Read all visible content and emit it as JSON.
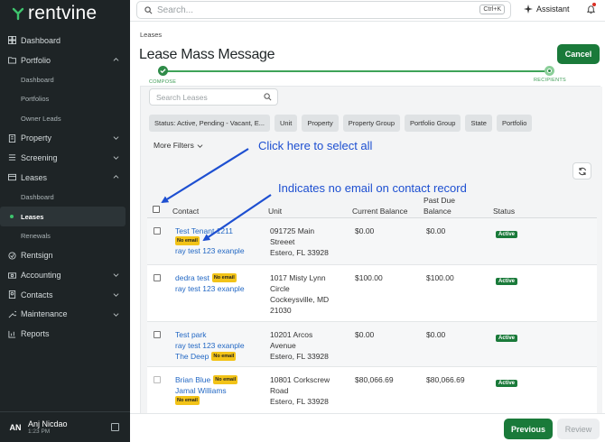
{
  "app": {
    "brand": "rentvine",
    "search_placeholder": "Search...",
    "search_shortcut": "Ctrl+K",
    "assistant_label": "Assistant"
  },
  "sidebar": {
    "items": [
      {
        "label": "Dashboard",
        "icon": "dashboard-icon"
      },
      {
        "label": "Portfolio",
        "icon": "folder-icon",
        "expanded": true
      },
      {
        "label": "Dashboard",
        "sub": true
      },
      {
        "label": "Portfolios",
        "sub": true
      },
      {
        "label": "Owner Leads",
        "sub": true
      },
      {
        "label": "Property",
        "icon": "building-icon"
      },
      {
        "label": "Screening",
        "icon": "list-icon"
      },
      {
        "label": "Leases",
        "icon": "layers-icon",
        "expanded": true
      },
      {
        "label": "Dashboard",
        "sub": true
      },
      {
        "label": "Leases",
        "sub": true,
        "active": true
      },
      {
        "label": "Renewals",
        "sub": true
      },
      {
        "label": "Rentsign",
        "icon": "sign-icon"
      },
      {
        "label": "Accounting",
        "icon": "dollar-icon"
      },
      {
        "label": "Contacts",
        "icon": "contacts-icon"
      },
      {
        "label": "Maintenance",
        "icon": "wrench-icon"
      },
      {
        "label": "Reports",
        "icon": "chart-icon"
      }
    ],
    "user": {
      "initials": "AN",
      "name": "Anj Nicdao",
      "time": "1:23 PM"
    }
  },
  "header": {
    "breadcrumb": "Leases",
    "title": "Lease Mass Message",
    "cancel_label": "Cancel",
    "steps": [
      "COMPOSE",
      "RECIPIENTS"
    ]
  },
  "filters": {
    "search_placeholder": "Search Leases",
    "chips": [
      "Status: Active, Pending - Vacant, E...",
      "Unit",
      "Property",
      "Property Group",
      "Portfolio Group",
      "State",
      "Portfolio"
    ],
    "more_filters_label": "More Filters"
  },
  "table": {
    "headers": {
      "contact": "Contact",
      "unit": "Unit",
      "balance": "Current Balance",
      "past_due_1": "Past Due",
      "past_due_2": "Balance",
      "status": "Status"
    },
    "no_email_label": "No email",
    "rows": [
      {
        "contacts": [
          "Test Tenant 1211",
          "ray test 123 exanple"
        ],
        "unit": [
          "091725 Main",
          "Streeet",
          "Estero, FL 33928"
        ],
        "balance": "$0.00",
        "past_due": "$0.00",
        "status": "Active"
      },
      {
        "contacts": [
          "dedra test",
          "ray test 123 exanple"
        ],
        "unit": [
          "1017 Misty Lynn",
          "Circle",
          "Cockeysville, MD",
          "21030"
        ],
        "balance": "$100.00",
        "past_due": "$100.00",
        "status": "Active"
      },
      {
        "contacts": [
          "Test park",
          "ray test 123 exanple",
          "The Deep"
        ],
        "unit": [
          "10201 Arcos",
          "Avenue",
          "Estero, FL 33928"
        ],
        "balance": "$0.00",
        "past_due": "$0.00",
        "status": "Active"
      },
      {
        "contacts": [
          "Brian Blue",
          "Jamal Williams"
        ],
        "unit": [
          "10801 Corkscrew",
          "Road",
          "Estero, FL 33928"
        ],
        "balance": "$80,066.69",
        "past_due": "$80,066.69",
        "status": "Active"
      }
    ]
  },
  "annotations": {
    "select_all": "Click here to select all",
    "no_email": "Indicates no email on contact record"
  },
  "footer": {
    "previous_label": "Previous",
    "review_label": "Review"
  },
  "colors": {
    "brand_green": "#1a7a3a",
    "sidebar_bg": "#1e2426",
    "link_blue": "#2368c4",
    "annotation_blue": "#1d4fd1",
    "no_email_yellow": "#f2c318"
  }
}
